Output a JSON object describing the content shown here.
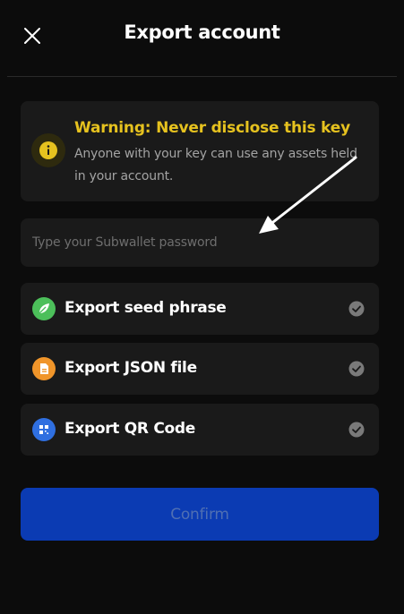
{
  "header": {
    "title": "Export account",
    "close_icon": "close-icon"
  },
  "warning": {
    "title": "Warning: Never disclose this key",
    "text": "Anyone with your key can use any assets held in your account.",
    "icon": "info-icon",
    "accent_color": "#e6c21f"
  },
  "password": {
    "placeholder": "Type your Subwallet password",
    "value": ""
  },
  "options": [
    {
      "label": "Export seed phrase",
      "icon": "leaf-icon",
      "color": "#4cbf5a"
    },
    {
      "label": "Export JSON file",
      "icon": "file-icon",
      "color": "#f0952a"
    },
    {
      "label": "Export QR Code",
      "icon": "qr-code-icon",
      "color": "#2f6fe0"
    }
  ],
  "confirm": {
    "label": "Confirm",
    "color": "#0b3bb3"
  }
}
